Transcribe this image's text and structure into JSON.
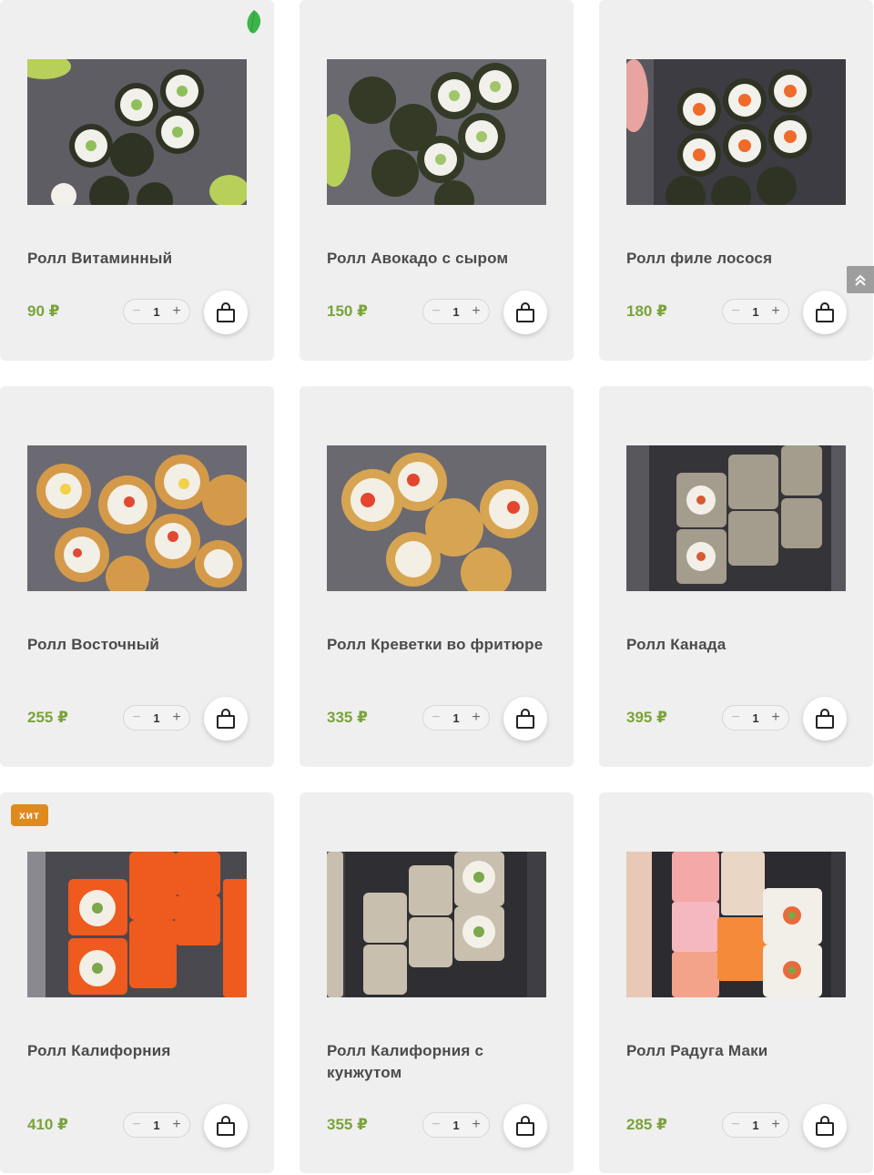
{
  "currency": "₽",
  "badge_hit": "хит",
  "products": [
    {
      "name": "Ролл Витаминный",
      "price": "90 ₽",
      "qty": "1",
      "badge": "leaf-icon"
    },
    {
      "name": "Ролл Авокадо с сыром",
      "price": "150 ₽",
      "qty": "1"
    },
    {
      "name": "Ролл филе лосося",
      "price": "180 ₽",
      "qty": "1"
    },
    {
      "name": "Ролл Восточный",
      "price": "255 ₽",
      "qty": "1"
    },
    {
      "name": "Ролл Креветки во фритюре",
      "price": "335 ₽",
      "qty": "1"
    },
    {
      "name": "Ролл Канада",
      "price": "395 ₽",
      "qty": "1"
    },
    {
      "name": "Ролл Калифорния",
      "price": "410 ₽",
      "qty": "1",
      "badge": "хит"
    },
    {
      "name": "Ролл Калифорния с кунжутом",
      "price": "355 ₽",
      "qty": "1"
    },
    {
      "name": "Ролл Радуга Маки",
      "price": "285 ₽",
      "qty": "1"
    }
  ],
  "stepper": {
    "minus": "−",
    "plus": "+"
  },
  "colors": {
    "price": "#7aa33a",
    "card_bg": "#efefef",
    "badge_hit": "#e08a1e",
    "leaf": "#3cb54a"
  },
  "icons": {
    "cart": "shopping-bag-icon",
    "scroll_top": "double-chevron-up-icon",
    "leaf": "leaf-icon"
  }
}
